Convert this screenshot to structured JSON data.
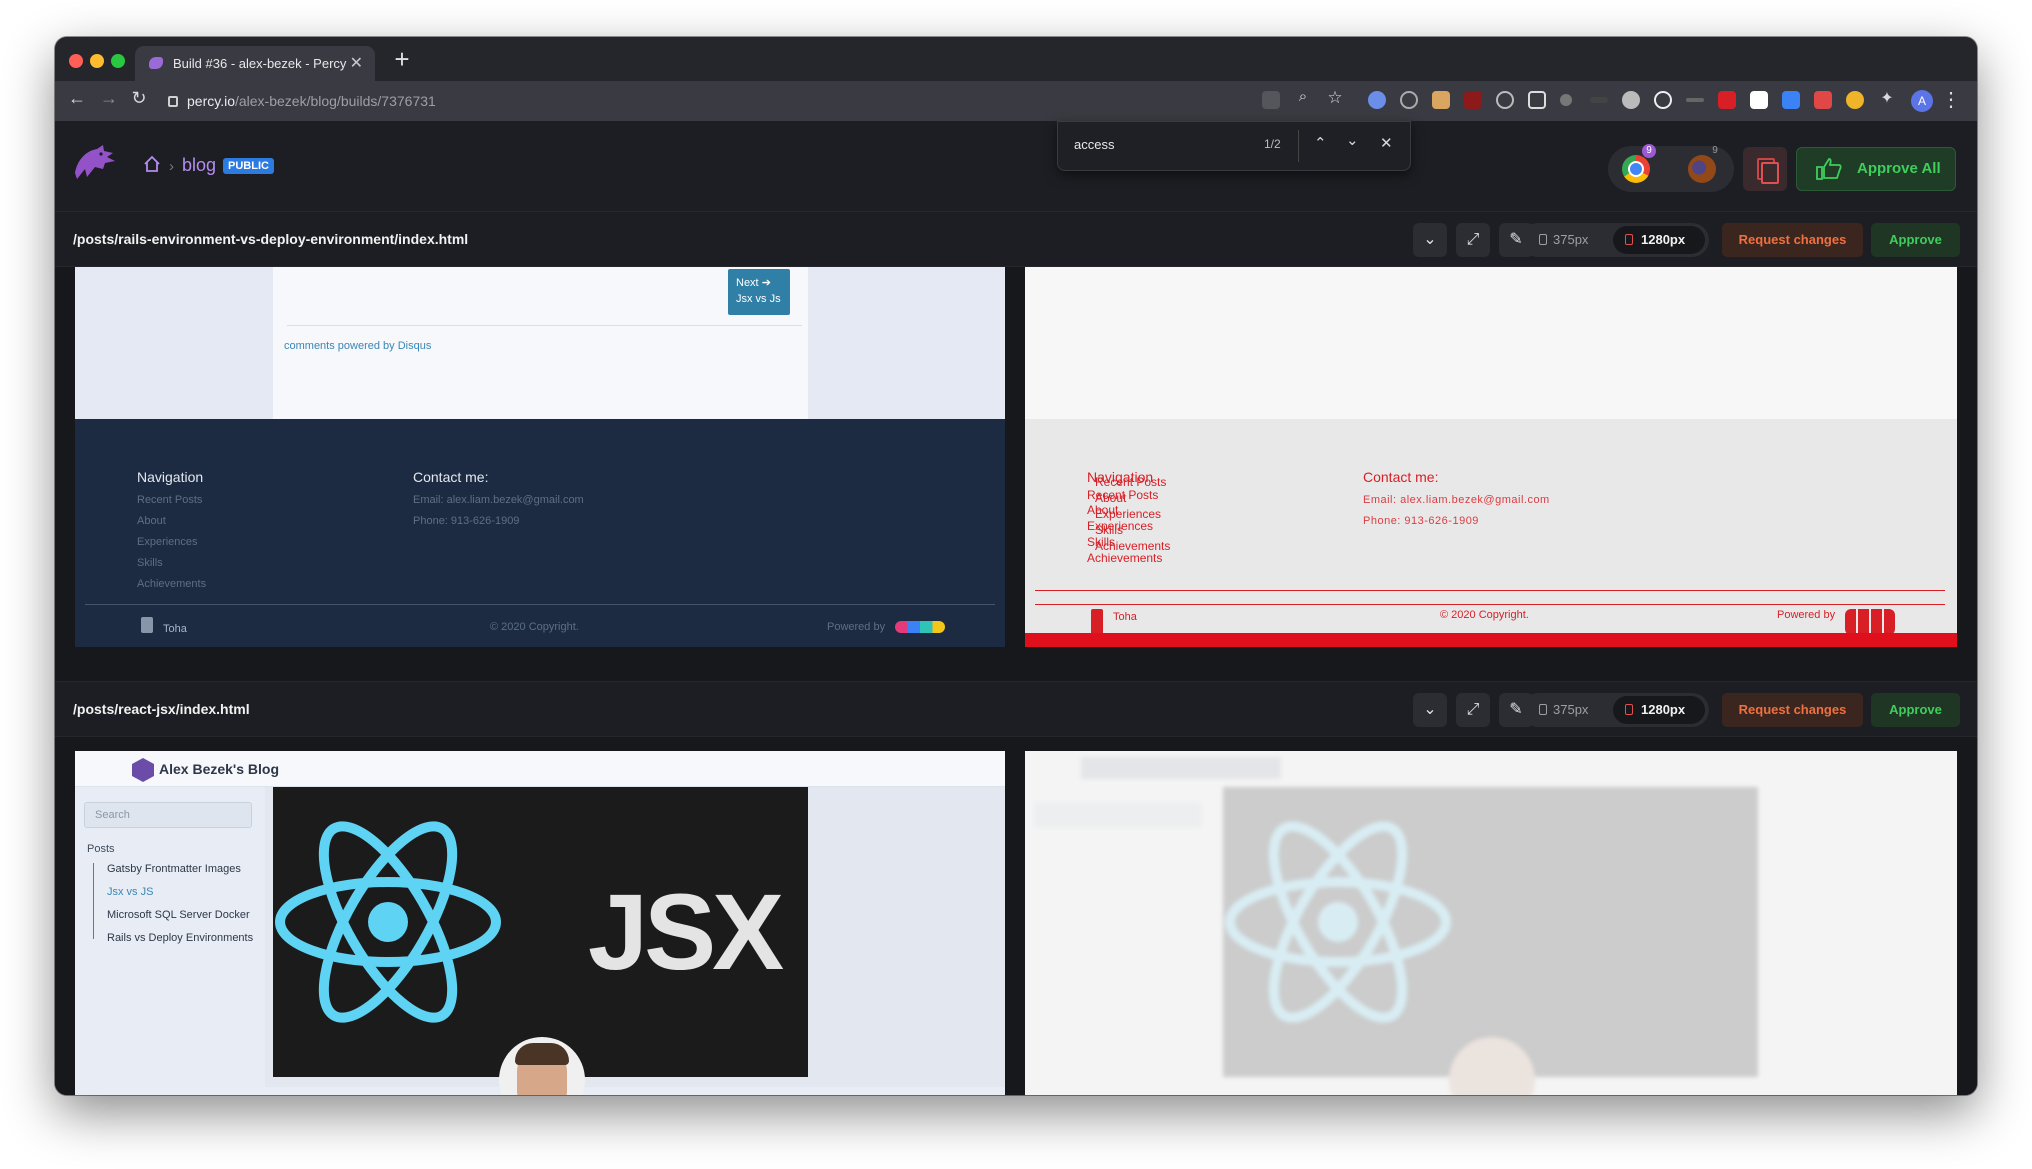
{
  "browser": {
    "tab_title": "Build #36 - alex-bezek - Percy",
    "url_domain": "percy.io",
    "url_path": "/alex-bezek/blog/builds/7376731"
  },
  "find_bar": {
    "query": "access",
    "count": "1/2"
  },
  "header": {
    "breadcrumb_project": "blog",
    "badge": "PUBLIC",
    "chrome_count": "9",
    "firefox_count": "9",
    "approve_all": "Approve All"
  },
  "snapshots": [
    {
      "name": "/posts/rails-environment-vs-deploy-environment/index.html",
      "width_small": "375px",
      "width_large": "1280px",
      "request_changes": "Request changes",
      "approve": "Approve",
      "base": {
        "next_label": "Next",
        "next_title": "Jsx vs Js",
        "disqus_text": "comments powered by Disqus",
        "nav_heading": "Navigation",
        "nav_links": [
          "Recent Posts",
          "About",
          "Experiences",
          "Skills",
          "Achievements"
        ],
        "contact_heading": "Contact me:",
        "email": "Email: alex.liam.bezek@gmail.com",
        "phone": "Phone: 913-626-1909",
        "brand": "Toha",
        "copyright": "© 2020 Copyright.",
        "powered_by": "Powered by"
      },
      "diff": {
        "nav_heading": "Navigation",
        "nav_links_a": [
          "Recent Posts",
          "About",
          "Experiences",
          "Skills",
          "Achievements"
        ],
        "nav_links_b": [
          "Recent Posts",
          "About",
          "Experiences",
          "Skills",
          "Achievements"
        ],
        "contact_heading": "Contact me:",
        "email": "Email: alex.liam.bezek@gmail.com",
        "phone": "Phone: 913-626-1909",
        "brand": "Toha",
        "copyright": "© 2020 Copyright.",
        "powered_by": "Powered by"
      }
    },
    {
      "name": "/posts/react-jsx/index.html",
      "width_small": "375px",
      "width_large": "1280px",
      "request_changes": "Request changes",
      "approve": "Approve",
      "base": {
        "site_title": "Alex Bezek's Blog",
        "search_placeholder": "Search",
        "posts_heading": "Posts",
        "post_items": [
          "Gatsby Frontmatter Images",
          "Jsx vs JS",
          "Microsoft SQL Server Docker",
          "Rails vs Deploy Environments"
        ],
        "hero_text": "JSX"
      }
    }
  ],
  "colors": {
    "accent_purple": "#b48cf0",
    "approve_green": "#3fce5c",
    "request_orange": "#ef7040",
    "diff_red": "#d81f26"
  }
}
